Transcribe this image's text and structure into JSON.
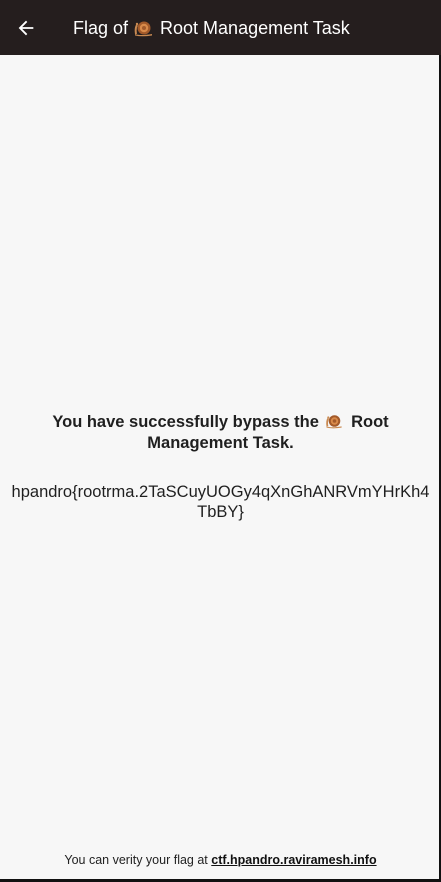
{
  "app_bar": {
    "title_prefix": "Flag of",
    "title_suffix": "Root Management Task",
    "background": "#251e1e",
    "icons": [
      "back-arrow-icon",
      "snail-icon"
    ]
  },
  "content": {
    "message_prefix": "You have successfully bypass the",
    "message_suffix": "Root Management Task.",
    "flag": "hpandro{rootrma.2TaSCuyUOGy4qXnGhANRVmYHrKh4TbBY}"
  },
  "footer": {
    "text": "You can verity your flag at",
    "link": "ctf.hpandro.raviramesh.info"
  }
}
